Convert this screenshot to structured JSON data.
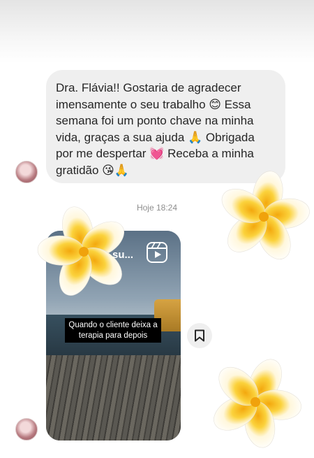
{
  "message": {
    "text": "Dra. Flávia!! Gostaria de agradecer imensamente o seu trabalho 😊 Essa semana foi um ponto chave na minha vida, graças a sua ajuda 🙏 Obrigada por me despertar 💓 Receba a minha gratidão 😘🙏"
  },
  "timestamp": "Hoje 18:24",
  "reel": {
    "title": "su...",
    "caption": "Quando o cliente deixa a terapia para depois"
  },
  "colors": {
    "bubble": "#efefef",
    "text": "#262626",
    "timestamp": "#8e8e8e",
    "petal": "#ffffff",
    "flower_center": "#f2b51a"
  },
  "icons": {
    "reel": "reels-icon",
    "save": "bookmark-icon",
    "decor": "plumeria-flower"
  }
}
